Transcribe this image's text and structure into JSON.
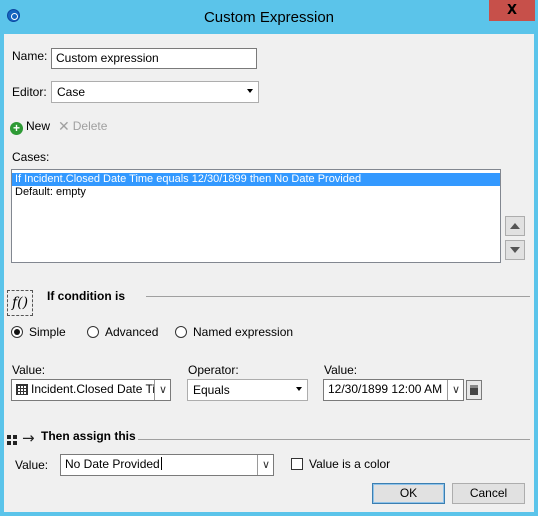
{
  "window": {
    "title": "Custom Expression",
    "close_label": "X"
  },
  "name_field": {
    "label": "Name:",
    "value": "Custom expression"
  },
  "editor_field": {
    "label": "Editor:",
    "value": "Case"
  },
  "toolbar": {
    "new_label": "New",
    "delete_label": "Delete"
  },
  "cases": {
    "label": "Cases:",
    "items": [
      {
        "text": "If Incident.Closed Date Time equals 12/30/1899 then No Date Provided",
        "selected": true
      },
      {
        "text": "Default: empty",
        "selected": false
      }
    ]
  },
  "condition": {
    "icon_text": "f()",
    "title": "If condition is",
    "modes": [
      {
        "label": "Simple",
        "checked": true
      },
      {
        "label": "Advanced",
        "checked": false
      },
      {
        "label": "Named expression",
        "checked": false
      }
    ],
    "value_label": "Value:",
    "value": "Incident.Closed Date Time",
    "operator_label": "Operator:",
    "operator": "Equals",
    "value2_label": "Value:",
    "value2": "12/30/1899 12:00 AM"
  },
  "assign": {
    "title": "Then assign this",
    "value_label": "Value:",
    "value": "No Date Provided",
    "is_color_label": "Value is a color",
    "is_color_checked": false
  },
  "buttons": {
    "ok": "OK",
    "cancel": "Cancel"
  },
  "colors": {
    "titlebar": "#5bc4ea",
    "close": "#c7504a",
    "selection": "#3399ff",
    "new_icon": "#2e9a35"
  }
}
